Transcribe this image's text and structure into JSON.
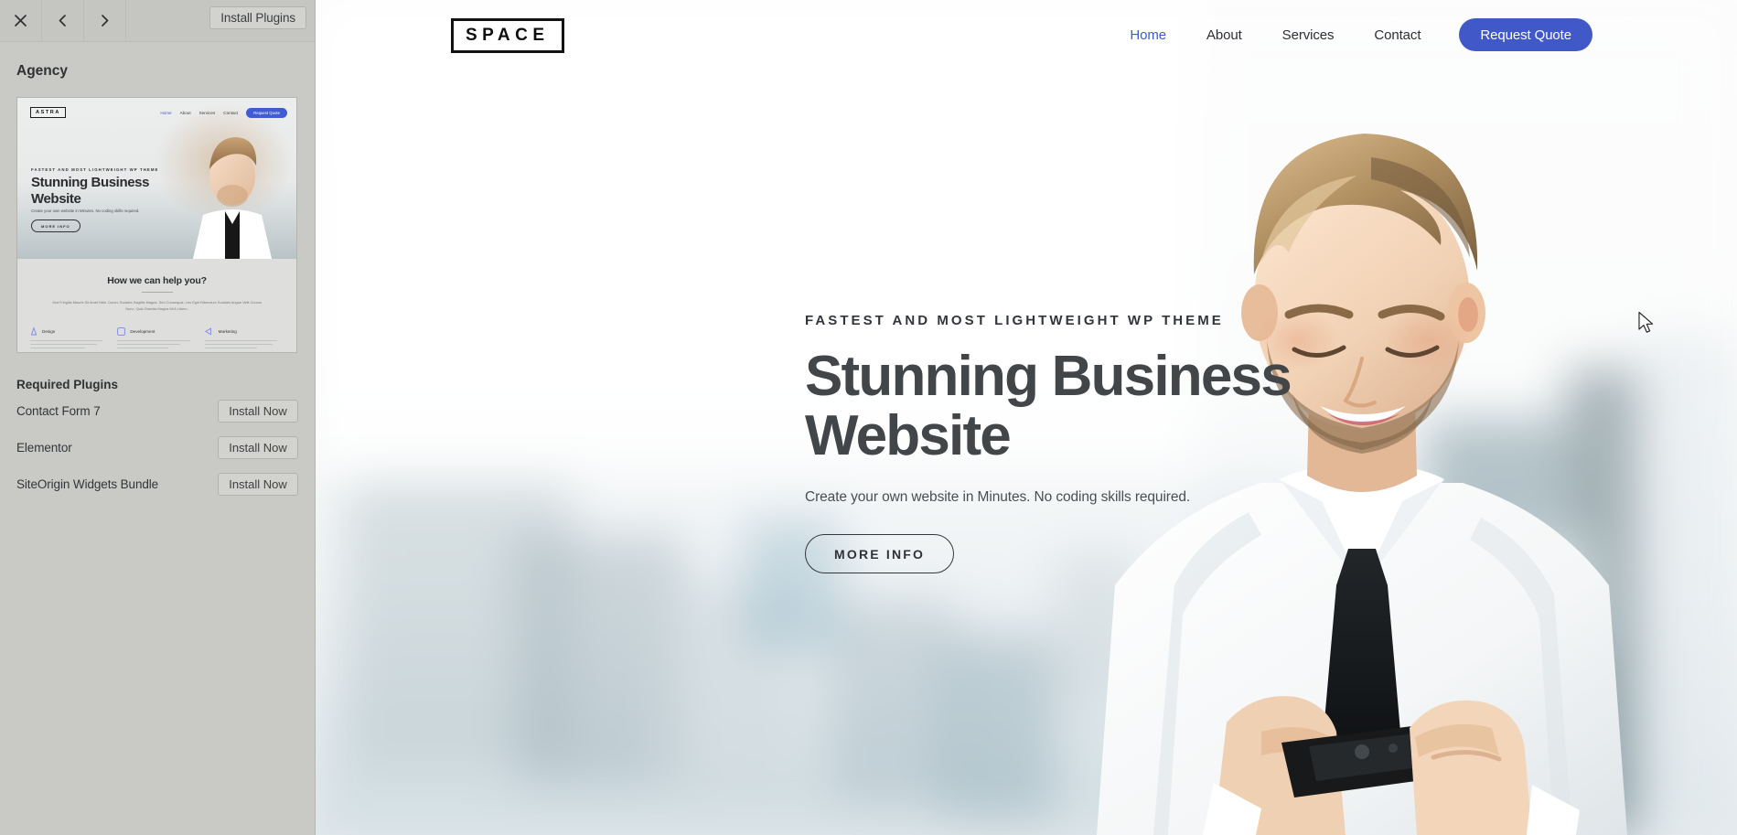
{
  "sidebar": {
    "toolbar": {
      "close_label": "×",
      "back_label": "‹",
      "forward_label": "›",
      "install_plugins_label": "Install Plugins"
    },
    "theme_title": "Agency",
    "required_plugins_title": "Required Plugins",
    "plugins": [
      {
        "name": "Contact Form 7",
        "action": "Install Now"
      },
      {
        "name": "Elementor",
        "action": "Install Now"
      },
      {
        "name": "SiteOrigin Widgets Bundle",
        "action": "Install Now"
      }
    ],
    "thumbnail": {
      "logo": "ASTRA",
      "nav": [
        "Home",
        "About",
        "Services",
        "Contact"
      ],
      "cta": "Request Quote",
      "eyebrow": "FASTEST AND MOST LIGHTWEIGHT WP THEME",
      "headline_line1": "Stunning Business",
      "headline_line2": "Website",
      "subcopy": "Create your own website in Minutes. No coding skills required.",
      "button": "MORE INFO",
      "section_title": "How we can help you?",
      "section_lead": "Sed Fringilla Mauris Sit Amet Nibh. Donec Sodales Sagittis Magna. Sed Consequat, Leo Eget Bibendum Sodales Augue Velit Cursus Nunc, Quis Gravida Magna Mi A Libero.",
      "columns": [
        {
          "title": "Design",
          "icon": "pen-icon"
        },
        {
          "title": "Development",
          "icon": "code-icon"
        },
        {
          "title": "Marketing",
          "icon": "megaphone-icon"
        }
      ]
    }
  },
  "preview": {
    "logo": "SPACE",
    "nav": [
      {
        "label": "Home",
        "active": true
      },
      {
        "label": "About",
        "active": false
      },
      {
        "label": "Services",
        "active": false
      },
      {
        "label": "Contact",
        "active": false
      }
    ],
    "cta_label": "Request Quote",
    "hero": {
      "eyebrow": "FASTEST AND MOST LIGHTWEIGHT WP THEME",
      "headline_line1": "Stunning Business",
      "headline_line2": "Website",
      "subcopy": "Create your own website in Minutes. No coding skills required.",
      "button": "MORE INFO"
    }
  },
  "colors": {
    "accent_blue": "#4159c8",
    "nav_active": "#3f5cd4",
    "heading": "#434649",
    "sidebar_bg": "#c9cac6",
    "button_bg": "#d2d3cf"
  }
}
